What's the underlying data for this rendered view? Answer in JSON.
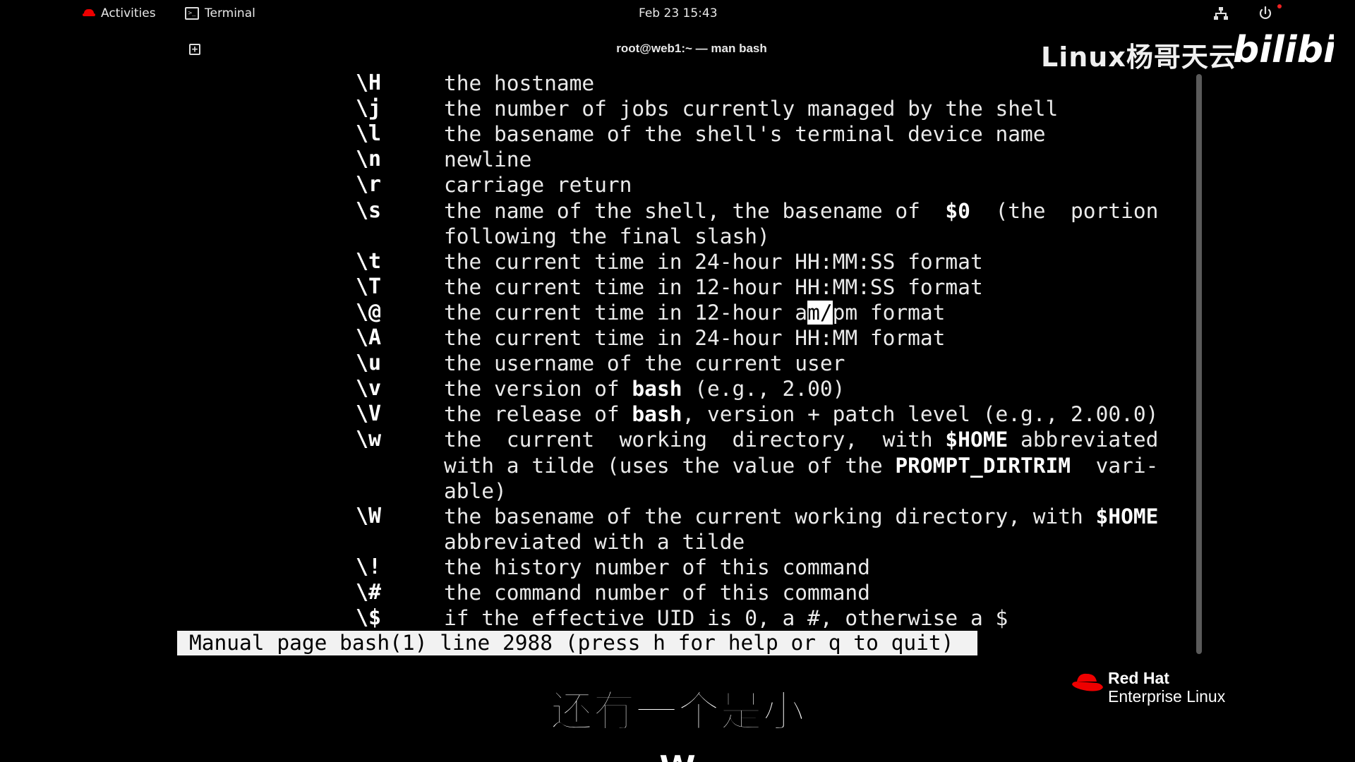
{
  "topbar": {
    "activities_label": "Activities",
    "app_label": "Terminal",
    "clock": "Feb 23  15:43"
  },
  "terminal": {
    "window_title": "root@web1:~ — man bash"
  },
  "man_rows": [
    {
      "esc": "\\H",
      "desc": "the hostname"
    },
    {
      "esc": "\\j",
      "desc": "the number of jobs currently managed by the shell"
    },
    {
      "esc": "\\l",
      "desc": "the basename of the shell's terminal device name"
    },
    {
      "esc": "\\n",
      "desc": "newline"
    },
    {
      "esc": "\\r",
      "desc": "carriage return"
    },
    {
      "esc": "\\s",
      "desc_pre": "the name of the shell, the basename of  ",
      "desc_bold": "$0",
      "desc_post": "  (the  portion"
    },
    {
      "esc": "",
      "desc": "following the final slash)"
    },
    {
      "esc": "\\t",
      "desc": "the current time in 24-hour HH:MM:SS format"
    },
    {
      "esc": "\\T",
      "desc": "the current time in 12-hour HH:MM:SS format"
    },
    {
      "esc": "\\@",
      "desc_pre": "the current time in 12-hour a",
      "desc_hl": "m/",
      "desc_post": "pm format"
    },
    {
      "esc": "\\A",
      "desc": "the current time in 24-hour HH:MM format"
    },
    {
      "esc": "\\u",
      "desc": "the username of the current user"
    },
    {
      "esc": "\\v",
      "desc_pre": "the version of ",
      "desc_bold": "bash",
      "desc_post": " (e.g., 2.00)"
    },
    {
      "esc": "\\V",
      "desc_pre": "the release of ",
      "desc_bold": "bash",
      "desc_post": ", version + patch level (e.g., 2.00.0)"
    },
    {
      "esc": "\\w",
      "desc_pre": "the  current  working  directory,  with ",
      "desc_bold": "$HOME",
      "desc_post": " abbreviated"
    },
    {
      "esc": "",
      "desc_pre": "with a tilde (uses the value of the ",
      "desc_bold": "PROMPT_DIRTRIM",
      "desc_post": "  vari-"
    },
    {
      "esc": "",
      "desc": "able)"
    },
    {
      "esc": "\\W",
      "desc_pre": "the basename of the current working directory, with ",
      "desc_bold": "$HOME",
      "desc_post": ""
    },
    {
      "esc": "",
      "desc": "abbreviated with a tilde"
    },
    {
      "esc": "\\!",
      "desc": "the history number of this command"
    },
    {
      "esc": "\\#",
      "desc": "the command number of this command"
    },
    {
      "esc": "\\$",
      "desc": "if the effective UID is 0, a #, otherwise a $"
    }
  ],
  "statusline": "Manual page bash(1) line 2988 (press h for help or q to quit)",
  "watermark": {
    "channel": "Linux杨哥天云",
    "platform_logo_text": "bilibili"
  },
  "brand": {
    "line1": "Red Hat",
    "line2": "Enterprise Linux"
  },
  "subtitle": "还有一个是小w",
  "colors": {
    "background": "#000000",
    "statusbar_bg": "#f2f2f2",
    "redhat_red": "#ee0000"
  },
  "icons": [
    "redhat-icon",
    "terminal-icon",
    "network-icon",
    "power-icon",
    "new-tab-icon"
  ]
}
